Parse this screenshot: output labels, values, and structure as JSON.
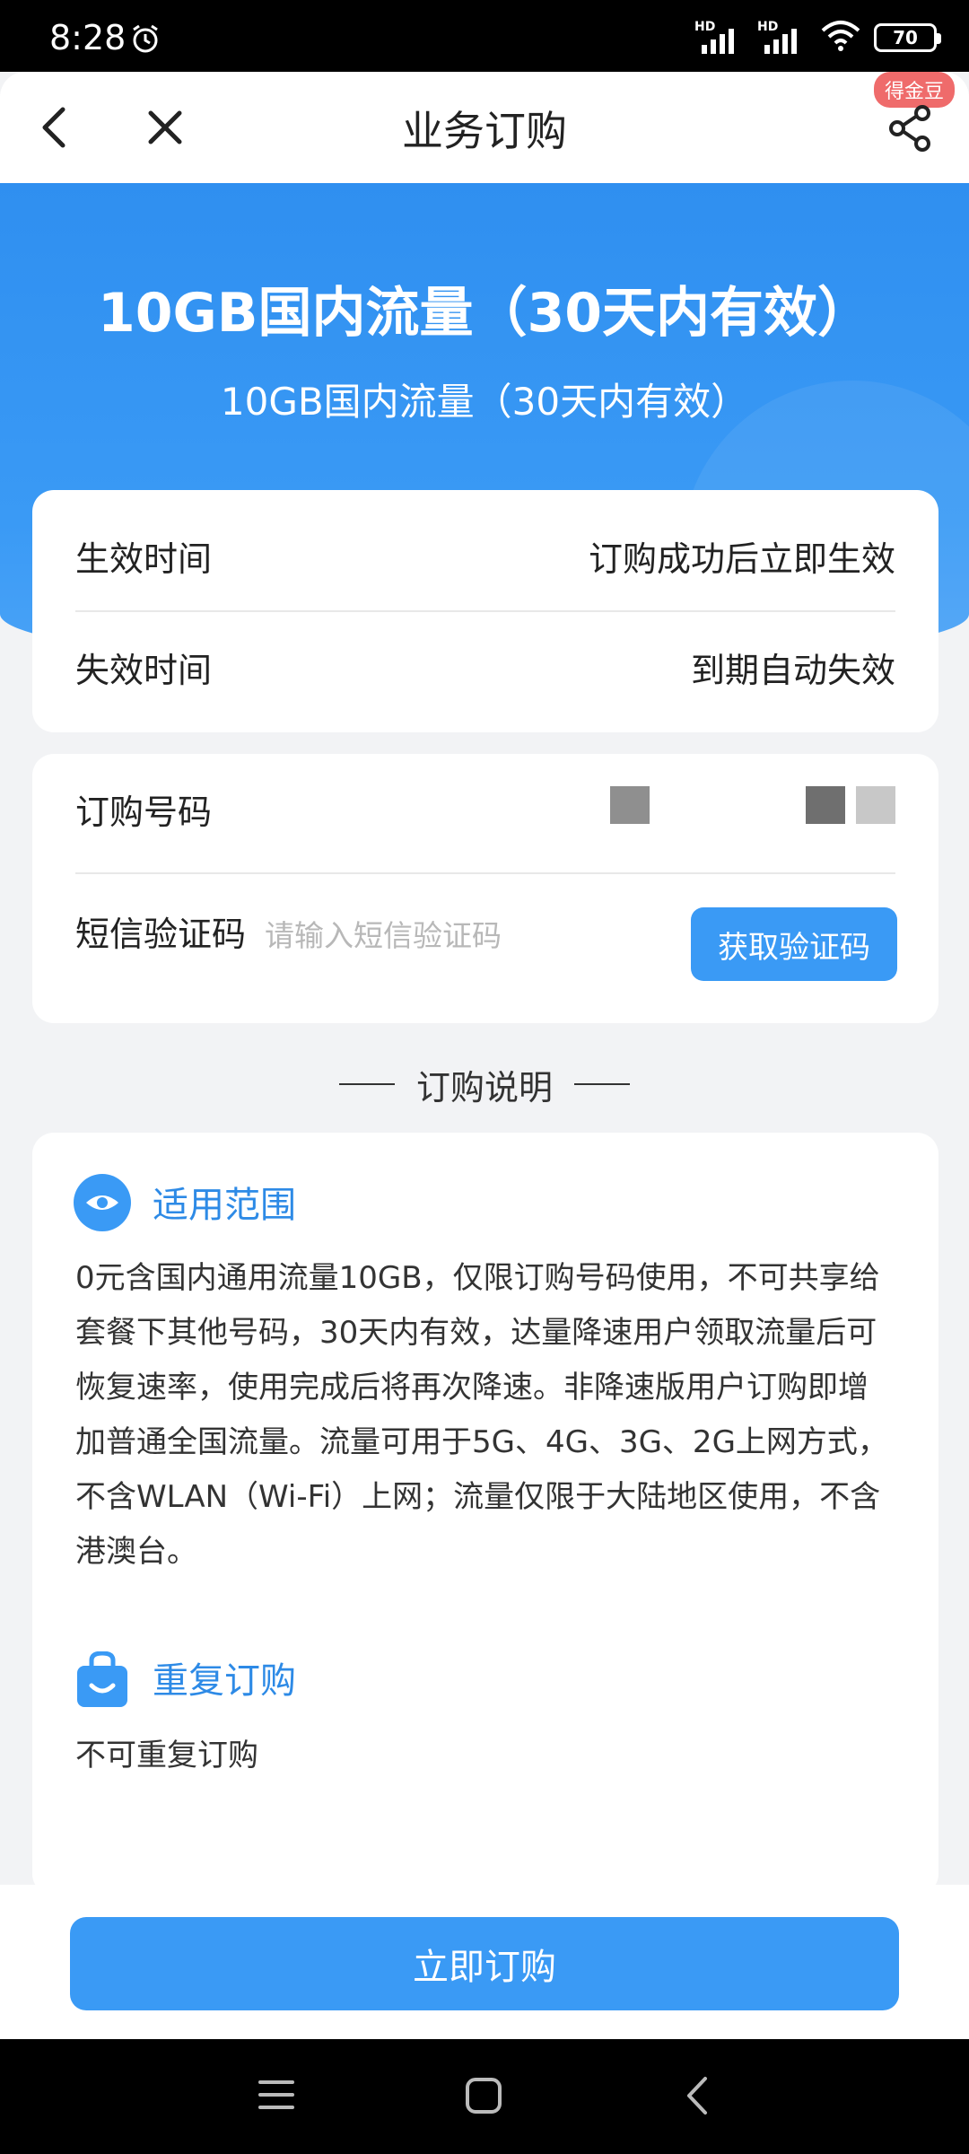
{
  "status": {
    "time": "8:28",
    "hd1": "HD",
    "hd2": "HD",
    "battery": "70"
  },
  "nav": {
    "title": "业务订购",
    "badge": "得金豆"
  },
  "hero": {
    "title": "10GB国内流量（30天内有效）",
    "subtitle": "10GB国内流量（30天内有效）"
  },
  "info": [
    {
      "label": "生效时间",
      "value": "订购成功后立即生效"
    },
    {
      "label": "失效时间",
      "value": "到期自动失效"
    }
  ],
  "form": {
    "phone_label": "订购号码",
    "sms_label": "短信验证码",
    "sms_placeholder": "请输入短信验证码",
    "sms_button": "获取验证码"
  },
  "section_heading": "订购说明",
  "sections": [
    {
      "icon": "eye-icon",
      "title": "适用范围",
      "text": "0元含国内通用流量10GB，仅限订购号码使用，不可共享给套餐下其他号码，30天内有效，达量降速用户领取流量后可恢复速率，使用完成后将再次降速。非降速版用户订购即增加普通全国流量。流量可用于5G、4G、3G、2G上网方式，不含WLAN（Wi-Fi）上网；流量仅限于大陆地区使用，不含港澳台。"
    },
    {
      "icon": "shopping-bag-icon",
      "title": "重复订购",
      "text": "不可重复订购"
    }
  ],
  "order_button": "立即订购",
  "colors": {
    "primary": "#3a9af5",
    "hero": "#2f8ff0",
    "section_title": "#2d8ae6",
    "badge": "#ef6b6b"
  }
}
